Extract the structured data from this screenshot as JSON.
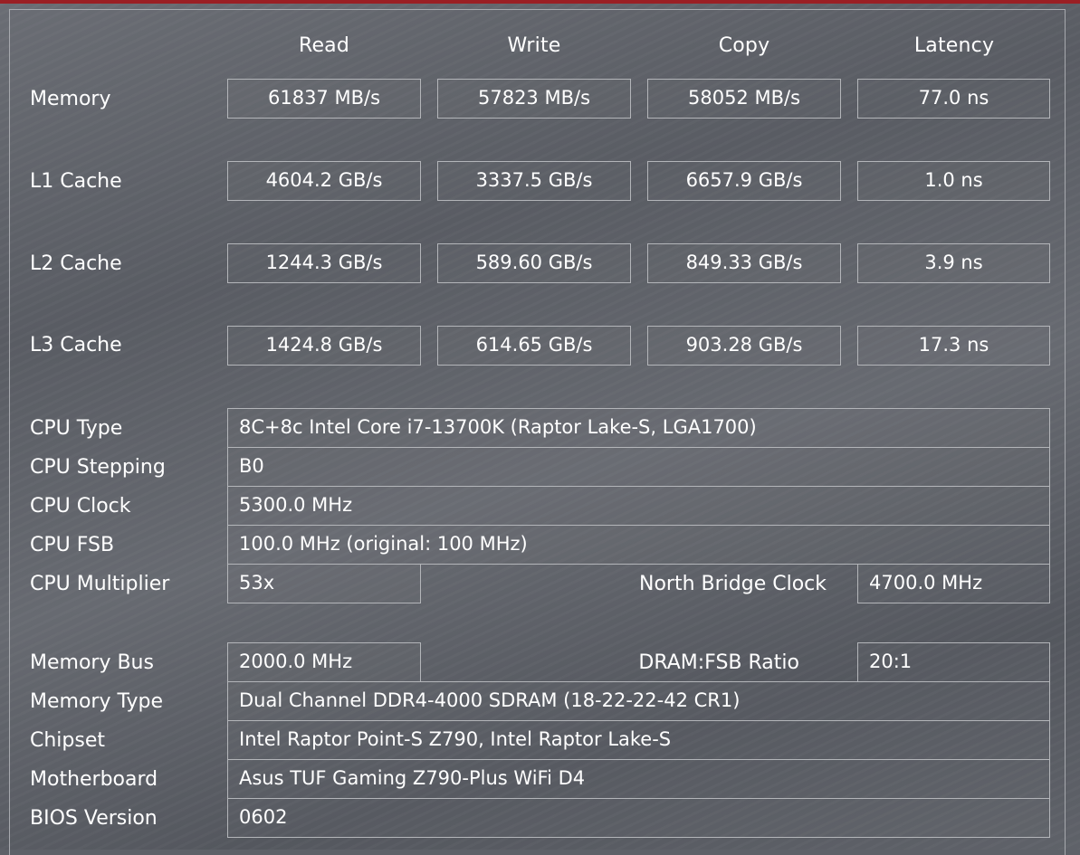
{
  "columns": [
    "Read",
    "Write",
    "Copy",
    "Latency"
  ],
  "bench_rows": [
    {
      "label": "Memory",
      "values": [
        "61837 MB/s",
        "57823 MB/s",
        "58052 MB/s",
        "77.0 ns"
      ]
    },
    {
      "label": "L1 Cache",
      "values": [
        "4604.2 GB/s",
        "3337.5 GB/s",
        "6657.9 GB/s",
        "1.0 ns"
      ]
    },
    {
      "label": "L2 Cache",
      "values": [
        "1244.3 GB/s",
        "589.60 GB/s",
        "849.33 GB/s",
        "3.9 ns"
      ]
    },
    {
      "label": "L3 Cache",
      "values": [
        "1424.8 GB/s",
        "614.65 GB/s",
        "903.28 GB/s",
        "17.3 ns"
      ]
    }
  ],
  "cpu": {
    "type_label": "CPU Type",
    "type_value": "8C+8c Intel Core i7-13700K  (Raptor Lake-S, LGA1700)",
    "stepping_label": "CPU Stepping",
    "stepping_value": "B0",
    "clock_label": "CPU Clock",
    "clock_value": "5300.0 MHz",
    "fsb_label": "CPU FSB",
    "fsb_value": "100.0 MHz  (original: 100 MHz)",
    "multiplier_label": "CPU Multiplier",
    "multiplier_value": "53x",
    "nb_clock_label": "North Bridge Clock",
    "nb_clock_value": "4700.0 MHz"
  },
  "memory": {
    "bus_label": "Memory Bus",
    "bus_value": "2000.0 MHz",
    "ratio_label": "DRAM:FSB Ratio",
    "ratio_value": "20:1",
    "type_label": "Memory Type",
    "type_value": "Dual Channel DDR4-4000 SDRAM  (18-22-22-42 CR1)",
    "chipset_label": "Chipset",
    "chipset_value": "Intel Raptor Point-S Z790, Intel Raptor Lake-S",
    "motherboard_label": "Motherboard",
    "motherboard_value": "Asus TUF Gaming Z790-Plus WiFi D4",
    "bios_label": "BIOS Version",
    "bios_value": "0602"
  },
  "colors": {
    "accent_bar": "#9a1f24",
    "background": "#5e6168",
    "border": "#b3b5b9",
    "text": "#ffffff"
  }
}
